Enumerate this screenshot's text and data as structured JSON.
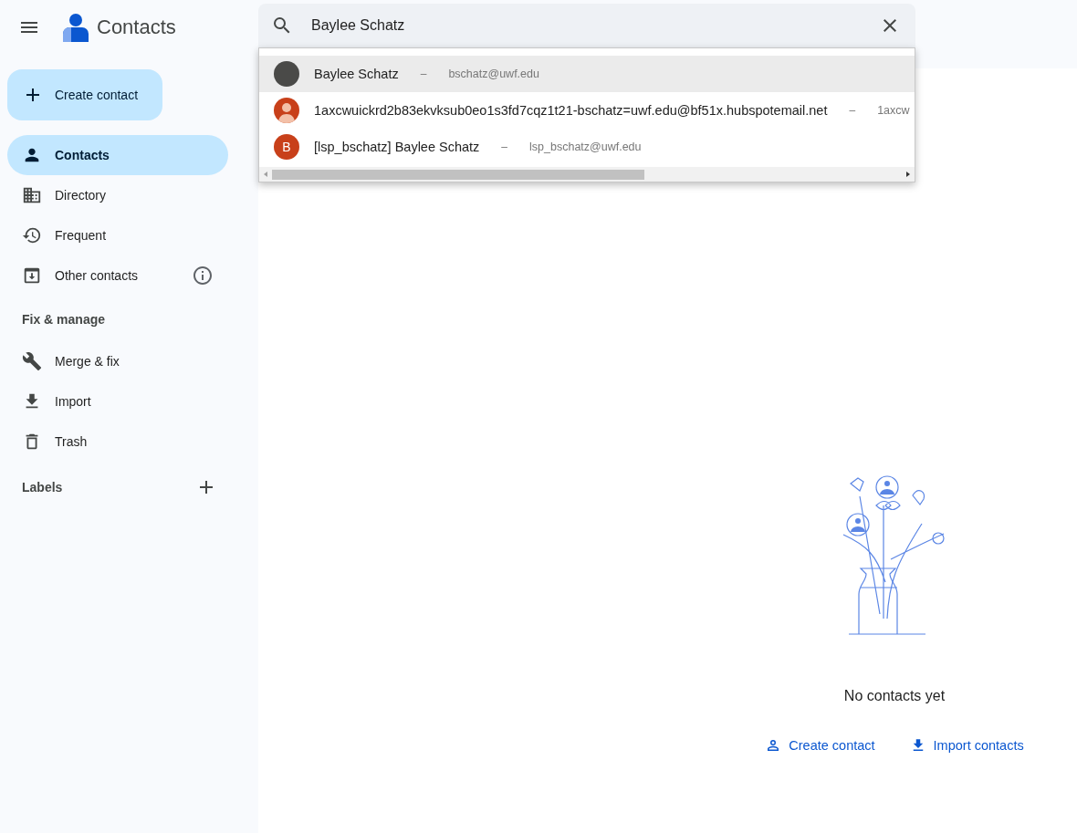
{
  "app": {
    "title": "Contacts"
  },
  "search": {
    "value": "Baylee Schatz"
  },
  "suggestions": [
    {
      "kind": "photo",
      "name": "Baylee Schatz",
      "separator": "–",
      "email": "bschatz@uwf.edu",
      "selected": true
    },
    {
      "kind": "silhouette",
      "name": "1axcwuickrd2b83ekvksub0eo1s3fd7cqz1t21-bschatz=uwf.edu@bf51x.hubspotemail.net",
      "separator": "–",
      "email": "1axcw",
      "selected": false
    },
    {
      "kind": "letter",
      "initial": "B",
      "name": "[lsp_bschatz] Baylee Schatz",
      "separator": "–",
      "email": "lsp_bschatz@uwf.edu",
      "selected": false
    }
  ],
  "sidebar": {
    "create_button": "Create contact",
    "nav": [
      {
        "label": "Contacts",
        "selected": true,
        "info": false
      },
      {
        "label": "Directory",
        "selected": false,
        "info": false
      },
      {
        "label": "Frequent",
        "selected": false,
        "info": false
      },
      {
        "label": "Other contacts",
        "selected": false,
        "info": true
      }
    ],
    "fix_manage": {
      "heading": "Fix & manage",
      "items": [
        {
          "label": "Merge & fix",
          "selected": false
        },
        {
          "label": "Import",
          "selected": false
        },
        {
          "label": "Trash",
          "selected": false
        }
      ]
    },
    "labels": {
      "heading": "Labels"
    }
  },
  "empty_state": {
    "message": "No contacts yet",
    "actions": [
      "Create contact",
      "Import contacts"
    ]
  }
}
